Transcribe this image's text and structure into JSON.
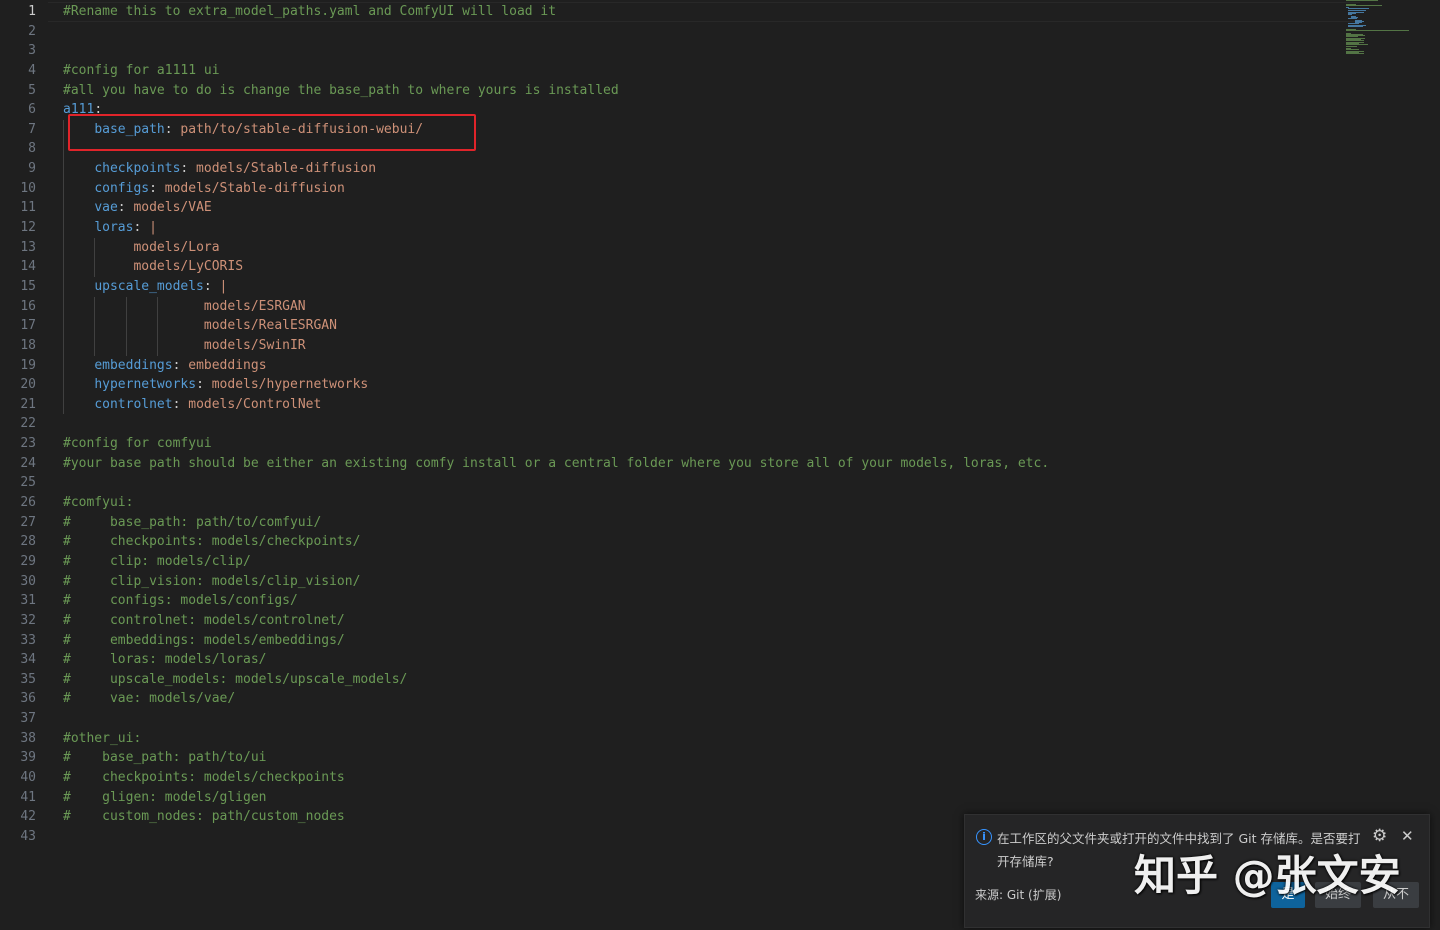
{
  "editor": {
    "active_line": 1,
    "lines": [
      "#Rename this to extra_model_paths.yaml and ComfyUI will load it",
      "",
      "",
      "#config for a1111 ui",
      "#all you have to do is change the base_path to where yours is installed",
      "a111:",
      "    base_path: path/to/stable-diffusion-webui/",
      "",
      "    checkpoints: models/Stable-diffusion",
      "    configs: models/Stable-diffusion",
      "    vae: models/VAE",
      "    loras: |",
      "         models/Lora",
      "         models/LyCORIS",
      "    upscale_models: |",
      "                  models/ESRGAN",
      "                  models/RealESRGAN",
      "                  models/SwinIR",
      "    embeddings: embeddings",
      "    hypernetworks: models/hypernetworks",
      "    controlnet: models/ControlNet",
      "",
      "#config for comfyui",
      "#your base path should be either an existing comfy install or a central folder where you store all of your models, loras, etc.",
      "",
      "#comfyui:",
      "#     base_path: path/to/comfyui/",
      "#     checkpoints: models/checkpoints/",
      "#     clip: models/clip/",
      "#     clip_vision: models/clip_vision/",
      "#     configs: models/configs/",
      "#     controlnet: models/controlnet/",
      "#     embeddings: models/embeddings/",
      "#     loras: models/loras/",
      "#     upscale_models: models/upscale_models/",
      "#     vae: models/vae/",
      "",
      "#other_ui:",
      "#    base_path: path/to/ui",
      "#    checkpoints: models/checkpoints",
      "#    gligen: models/gligen",
      "#    custom_nodes: path/custom_nodes",
      ""
    ]
  },
  "notification": {
    "icon": "info-icon",
    "message": "在工作区的父文件夹或打开的文件中找到了 Git 存储库。是否要打开存储库?",
    "source": "来源: Git (扩展)",
    "buttons": {
      "yes": "是",
      "always": "始终",
      "never": "从不"
    }
  },
  "watermark": "知乎 @张文安",
  "colors": {
    "background": "#1f1f1f",
    "comment": "#6a9955",
    "key": "#569cd6",
    "value": "#ce9178",
    "highlight_box": "#e0242a",
    "primary_button": "#0e639c"
  }
}
